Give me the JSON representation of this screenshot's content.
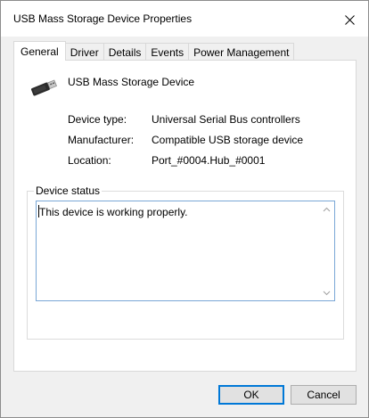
{
  "window": {
    "title": "USB Mass Storage Device Properties"
  },
  "tabs": [
    {
      "label": "General",
      "active": true
    },
    {
      "label": "Driver",
      "active": false
    },
    {
      "label": "Details",
      "active": false
    },
    {
      "label": "Events",
      "active": false
    },
    {
      "label": "Power Management",
      "active": false
    }
  ],
  "device": {
    "icon": "usb-connector-icon",
    "name": "USB Mass Storage Device",
    "properties": [
      {
        "label": "Device type:",
        "value": "Universal Serial Bus controllers"
      },
      {
        "label": "Manufacturer:",
        "value": "Compatible USB storage device"
      },
      {
        "label": "Location:",
        "value": "Port_#0004.Hub_#0001"
      }
    ]
  },
  "status": {
    "legend": "Device status",
    "text": "This device is working properly."
  },
  "buttons": {
    "ok": "OK",
    "cancel": "Cancel"
  },
  "colors": {
    "focus_border": "#0078d7",
    "textbox_border": "#7aa7d6"
  }
}
